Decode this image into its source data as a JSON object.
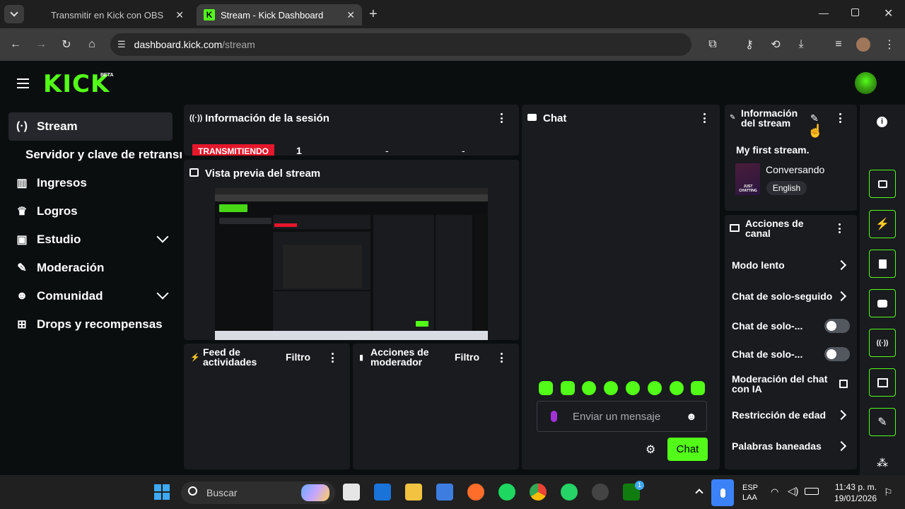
{
  "browser": {
    "tabs": [
      {
        "title": "Transmitir en Kick con OBS",
        "active": false
      },
      {
        "title": "Stream - Kick Dashboard",
        "active": true
      }
    ],
    "url_domain": "dashboard.kick.com",
    "url_path": "/stream"
  },
  "header": {
    "logo": "KICK",
    "beta": "BETA"
  },
  "sidebar": {
    "items": [
      {
        "label": "Stream",
        "icon": "broadcast-icon"
      },
      {
        "label": "Servidor y clave de retransm",
        "icon": ""
      },
      {
        "label": "Ingresos",
        "icon": "chart-icon"
      },
      {
        "label": "Logros",
        "icon": "trophy-icon"
      },
      {
        "label": "Estudio",
        "icon": "studio-icon"
      },
      {
        "label": "Moderación",
        "icon": "wrench-icon"
      },
      {
        "label": "Comunidad",
        "icon": "people-icon"
      },
      {
        "label": "Drops y recompensas",
        "icon": "gift-icon"
      }
    ]
  },
  "session": {
    "title": "Información de la sesión",
    "status": "TRANSMITIENDO",
    "viewers": "1",
    "stat2": "-",
    "stat3": "-"
  },
  "preview": {
    "title": "Vista previa del stream"
  },
  "feed": {
    "title_line1": "Feed de",
    "title_line2": "actividades",
    "filter": "Filtro"
  },
  "modactions": {
    "title_line1": "Acciones de",
    "title_line2": "moderador",
    "filter": "Filtro"
  },
  "chat": {
    "title": "Chat",
    "placeholder": "Enviar un mensaje",
    "send_label": "Chat"
  },
  "stream_info": {
    "title_line1": "Información",
    "title_line2": "del stream",
    "stream_title": "My first stream.",
    "category": "Conversando",
    "language": "English",
    "thumb_text": "JUST CHATTING"
  },
  "channel_actions": {
    "title_line1": "Acciones de",
    "title_line2": "canal",
    "items": [
      {
        "label": "Modo lento",
        "control": "arrow"
      },
      {
        "label": "Chat de solo-seguido",
        "control": "arrow"
      },
      {
        "label": "Chat de solo-...",
        "control": "toggle",
        "on": false
      },
      {
        "label": "Chat de solo-...",
        "control": "toggle",
        "on": false
      },
      {
        "label": "Moderación del chat con IA",
        "control": "external"
      },
      {
        "label": "Restricción de edad",
        "control": "arrow"
      },
      {
        "label": "Palabras baneadas",
        "control": "arrow"
      }
    ]
  },
  "taskbar": {
    "search": "Buscar",
    "lang1": "ESP",
    "lang2": "LAA",
    "time": "11:43 p. m.",
    "date": "19/01/2026",
    "badge": "1"
  },
  "colors": {
    "accent": "#53fc18",
    "live": "#e5172b",
    "panel": "#191b1f"
  }
}
